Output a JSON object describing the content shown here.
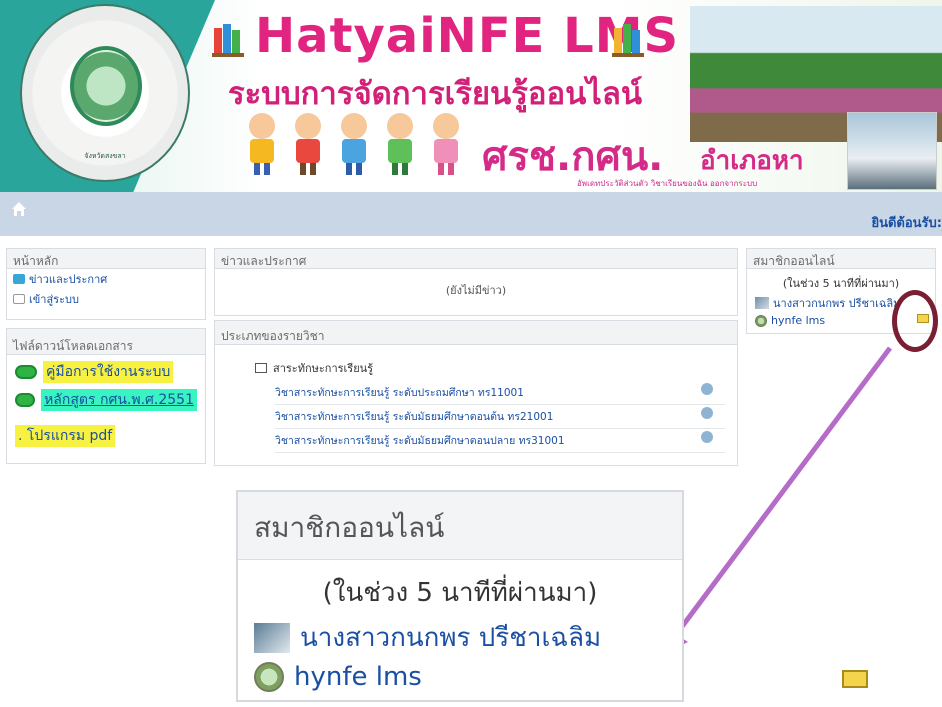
{
  "banner": {
    "title": "HatyaiNFE LMS",
    "subtitle": "ระบบการจัดการเรียนรู้ออนไลน์",
    "brand": "ศรช.กศน.",
    "district": "อำเภอหา",
    "submenu": "อัพเดทประวัติส่วนตัว  วิชาเรียนของฉัน  ออกจากระบบ",
    "seal_text": "จังหวัดสงขลา"
  },
  "navbar": {
    "home_icon": "home-icon",
    "welcome": "ยินดีต้อนรับ:"
  },
  "left": {
    "main_block": {
      "title": "หน้าหลัก",
      "items": [
        "ข่าวและประกาศ",
        "เข้าสู่ระบบ"
      ]
    },
    "download_block": {
      "title": "ไฟล์ดาวน์โหลดเอกสาร",
      "items": [
        "คู่มือการใช้งานระบบ",
        "หลักสูตร กศน.พ.ศ.2551"
      ],
      "pdf_line": ". โปรแกรม pdf"
    }
  },
  "center": {
    "news_block": {
      "title": "ข่าวและประกาศ",
      "empty": "(ยังไม่มีข่าว)"
    },
    "courses_block": {
      "title": "ประเภทของรายวิชา",
      "category": "สาระทักษะการเรียนรู้",
      "courses": [
        "วิชาสาระทักษะการเรียนรู้ ระดับประถมศึกษา ทร11001",
        "วิชาสาระทักษะการเรียนรู้ ระดับมัธยมศึกษาตอนต้น ทร21001",
        "วิชาสาระทักษะการเรียนรู้ ระดับมัธยมศึกษาตอนปลาย ทร31001"
      ]
    }
  },
  "right": {
    "online_block": {
      "title": "สมาชิกออนไลน์",
      "window": "(ในช่วง 5 นาทีที่ผ่านมา)",
      "users": [
        "นางสาวกนกพร ปรีชาเฉลิม",
        "hynfe lms"
      ]
    }
  },
  "zoom": {
    "title": "สมาชิกออนไลน์",
    "window": "(ในช่วง 5 นาทีที่ผ่านมา)",
    "users": [
      "นางสาวกนกพร ปรีชาเฉลิม",
      "hynfe lms"
    ]
  },
  "colors": {
    "brand_pink": "#e0247f",
    "nav_bg": "#c9d6e6",
    "link_blue": "#1a4fa3",
    "arrow_purple": "#b56cc9",
    "circle_marker": "#7a1f33"
  }
}
